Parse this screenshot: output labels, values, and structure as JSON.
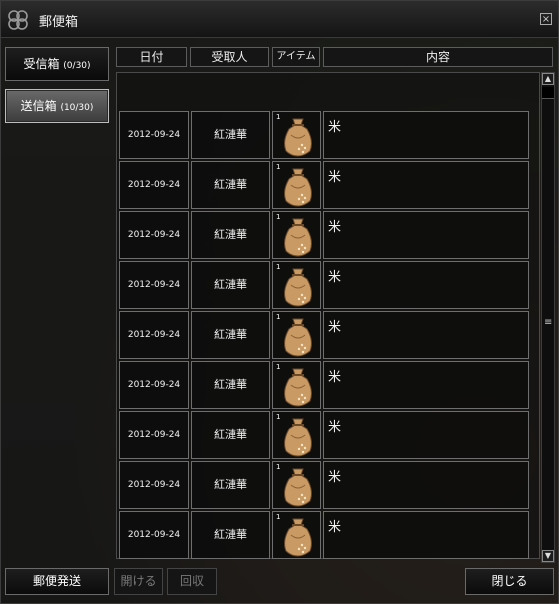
{
  "window": {
    "title": "郵便箱",
    "close_glyph": "×"
  },
  "tabs": [
    {
      "label": "受信箱",
      "count": "(0/30)",
      "active": false
    },
    {
      "label": "送信箱",
      "count": "(10/30)",
      "active": true
    }
  ],
  "columns": {
    "date": "日付",
    "recipient": "受取人",
    "item": "アイテム",
    "content": "内容"
  },
  "rows": [
    {
      "date": "2012-09-24",
      "recipient": "紅漣華",
      "item_count": "1",
      "item_icon": "rice-sack-icon",
      "content": "米"
    },
    {
      "date": "2012-09-24",
      "recipient": "紅漣華",
      "item_count": "1",
      "item_icon": "rice-sack-icon",
      "content": "米"
    },
    {
      "date": "2012-09-24",
      "recipient": "紅漣華",
      "item_count": "1",
      "item_icon": "rice-sack-icon",
      "content": "米"
    },
    {
      "date": "2012-09-24",
      "recipient": "紅漣華",
      "item_count": "1",
      "item_icon": "rice-sack-icon",
      "content": "米"
    },
    {
      "date": "2012-09-24",
      "recipient": "紅漣華",
      "item_count": "1",
      "item_icon": "rice-sack-icon",
      "content": "米"
    },
    {
      "date": "2012-09-24",
      "recipient": "紅漣華",
      "item_count": "1",
      "item_icon": "rice-sack-icon",
      "content": "米"
    },
    {
      "date": "2012-09-24",
      "recipient": "紅漣華",
      "item_count": "1",
      "item_icon": "rice-sack-icon",
      "content": "米"
    },
    {
      "date": "2012-09-24",
      "recipient": "紅漣華",
      "item_count": "1",
      "item_icon": "rice-sack-icon",
      "content": "米"
    },
    {
      "date": "2012-09-24",
      "recipient": "紅漣華",
      "item_count": "1",
      "item_icon": "rice-sack-icon",
      "content": "米"
    }
  ],
  "scrollbar": {
    "up": "▲",
    "down": "▼",
    "grip": "≡"
  },
  "buttons": {
    "send": "郵便発送",
    "open": "開ける",
    "retrieve": "回収",
    "close": "閉じる"
  },
  "colors": {
    "window_bg": "#121212",
    "border": "#6e6e6e",
    "sack": "#c99a63"
  }
}
